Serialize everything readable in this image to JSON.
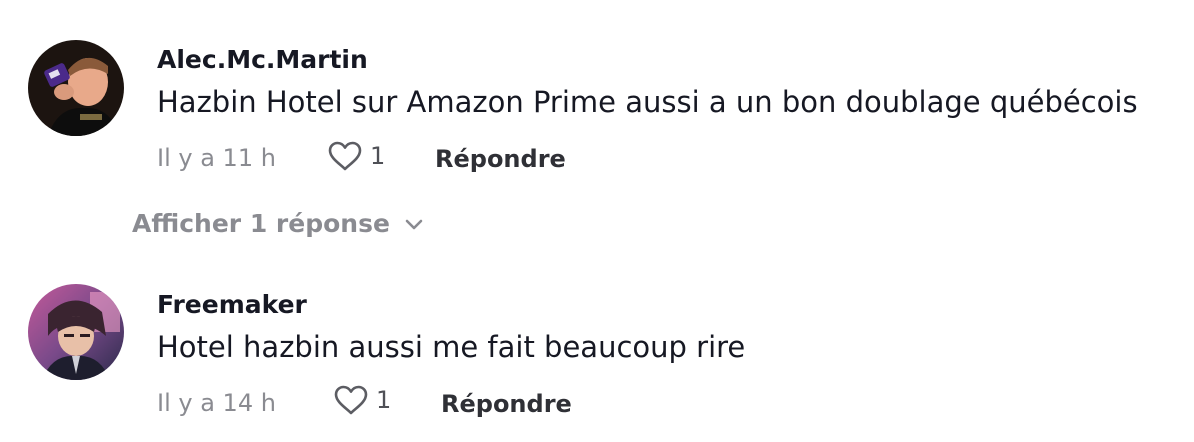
{
  "comments": [
    {
      "username": "Alec.Mc.Martin",
      "text": "Hazbin Hotel sur Amazon Prime aussi a un bon doublage québécois",
      "time": "Il y a 11 h",
      "likes": "1",
      "reply_label": "Répondre"
    },
    {
      "username": "Freemaker",
      "text": "Hotel hazbin aussi me fait beaucoup rire",
      "time": "Il y a 14 h",
      "likes": "1",
      "reply_label": "Répondre"
    }
  ],
  "view_replies_label": "Afficher 1 réponse",
  "icons": {
    "like": "heart-outline-icon",
    "expand": "chevron-down-icon"
  },
  "colors": {
    "text": "#161823",
    "muted": "#8a8b91",
    "reply": "#2f3036"
  }
}
